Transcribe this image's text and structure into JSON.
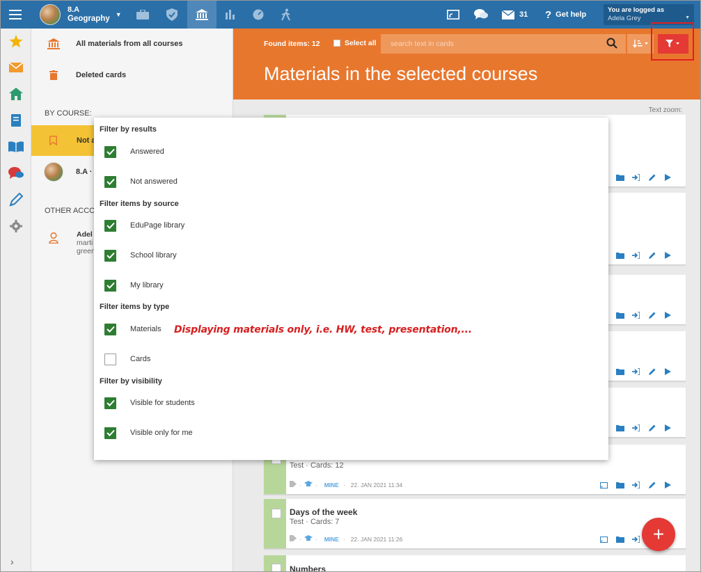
{
  "topbar": {
    "class_name": "8.A",
    "subject": "Geography",
    "messages_count": "31",
    "help_label": "Get help",
    "logged_label": "You are logged as",
    "user_name": "Adela Grey",
    "icons": [
      "menu-icon",
      "briefcase-icon",
      "shield-check-icon",
      "institution-icon",
      "bar-chart-icon",
      "speedometer-icon",
      "walking-icon",
      "screen-cast-icon",
      "chat-bubbles-icon",
      "envelope-icon"
    ]
  },
  "rail": {
    "icons": [
      "star-icon",
      "envelope-icon",
      "home-icon",
      "notebook-icon",
      "open-book-icon",
      "chat-icon",
      "pen-icon",
      "gear-icon",
      "chevron-right-icon"
    ]
  },
  "left_panel": {
    "all_materials": "All materials from all courses",
    "deleted_cards": "Deleted cards",
    "by_course_heading": "BY COURSE:",
    "selected_course": "Not a",
    "course_item": "8.A ·",
    "other_heading": "OTHER ACCO",
    "account_line1": "Adel",
    "account_line2": "marti",
    "account_line3": "green"
  },
  "header": {
    "found_items": "Found items: 12",
    "select_all": "Select all",
    "search_placeholder": "search text in cards",
    "title": "Materials in the selected courses",
    "text_zoom": "Text zoom:"
  },
  "cards": [
    {
      "title": "",
      "subtitle": "Test · Cards: 12",
      "mine": "MINE",
      "date": "22. JAN 2021 11:34"
    },
    {
      "title": "Days of the week",
      "subtitle": "Test · Cards: 7",
      "mine": "MINE",
      "date": "22. JAN 2021 11:26"
    },
    {
      "title": "Numbers",
      "subtitle": "",
      "mine": "",
      "date": ""
    }
  ],
  "filter": {
    "groups": [
      {
        "title": "Filter by results",
        "items": [
          {
            "label": "Answered",
            "checked": true
          },
          {
            "label": "Not answered",
            "checked": true
          }
        ]
      },
      {
        "title": "Filter items by source",
        "items": [
          {
            "label": "EduPage library",
            "checked": true
          },
          {
            "label": "School library",
            "checked": true
          },
          {
            "label": "My library",
            "checked": true
          }
        ]
      },
      {
        "title": "Filter items by type",
        "items": [
          {
            "label": "Materials",
            "checked": true
          },
          {
            "label": "Cards",
            "checked": false
          }
        ]
      },
      {
        "title": "Filter by visibility",
        "items": [
          {
            "label": "Visible for students",
            "checked": true
          },
          {
            "label": "Visible only for me",
            "checked": true
          }
        ]
      }
    ],
    "annotation": "Displaying materials only, i.e. HW, test, presentation,..."
  },
  "colors": {
    "topbar": "#2a6fa8",
    "orange": "#e8772e",
    "accent_red": "#e53935",
    "check_green": "#2e7d32",
    "stripe_green": "#b7d79a",
    "selected_yellow": "#f4c235"
  }
}
